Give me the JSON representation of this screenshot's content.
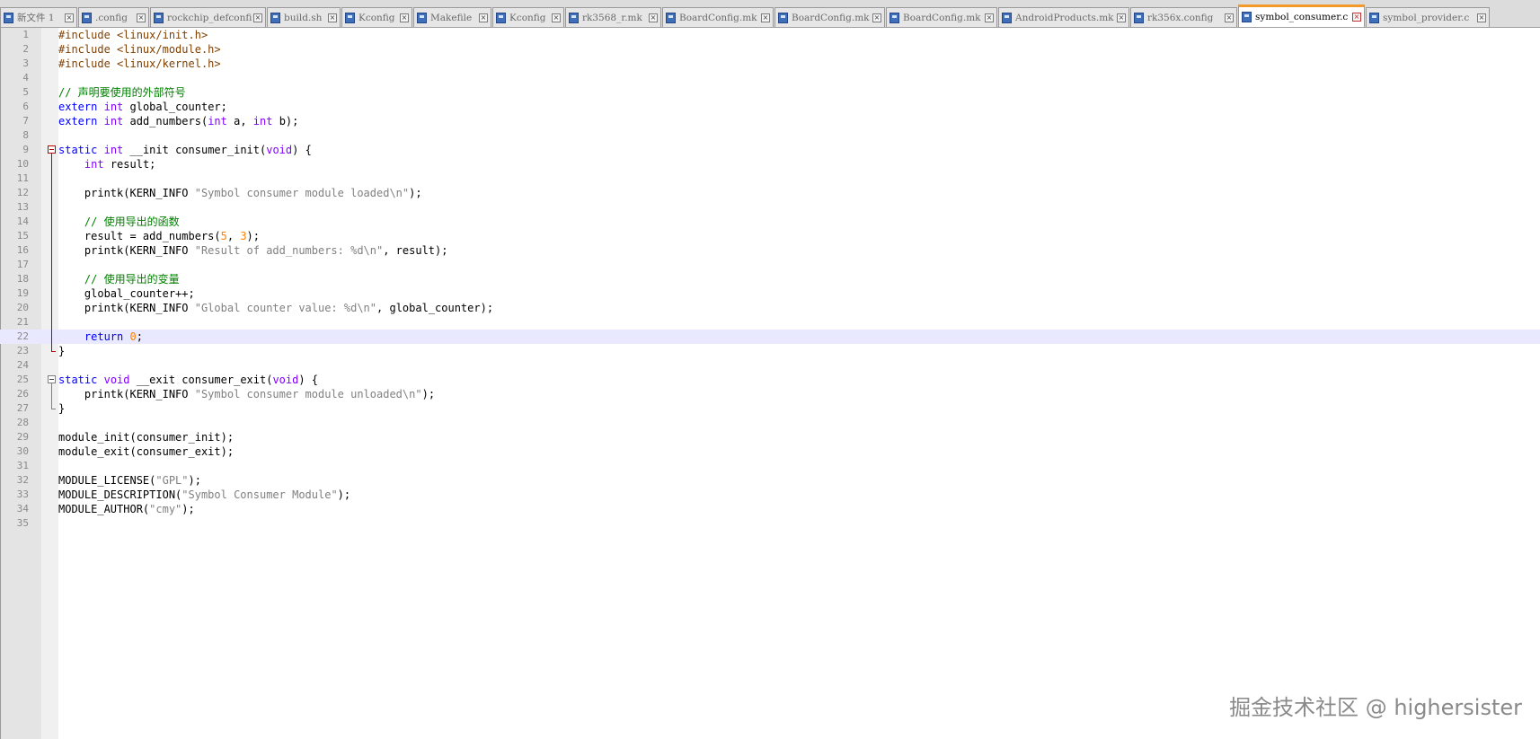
{
  "tabs": [
    {
      "label": "新文件 1",
      "active": false,
      "width": 86
    },
    {
      "label": ".config",
      "active": false,
      "width": 79
    },
    {
      "label": "rockchip_defconfig",
      "active": false,
      "width": 129
    },
    {
      "label": "build.sh",
      "active": false,
      "width": 82
    },
    {
      "label": "Kconfig",
      "active": false,
      "width": 79
    },
    {
      "label": "Makefile",
      "active": false,
      "width": 87
    },
    {
      "label": "Kconfig",
      "active": false,
      "width": 80
    },
    {
      "label": "rk3568_r.mk",
      "active": false,
      "width": 107
    },
    {
      "label": "BoardConfig.mk",
      "active": false,
      "width": 124
    },
    {
      "label": "BoardConfig.mk",
      "active": false,
      "width": 123
    },
    {
      "label": "BoardConfig.mk",
      "active": false,
      "width": 124
    },
    {
      "label": "AndroidProducts.mk",
      "active": false,
      "width": 146
    },
    {
      "label": "rk356x.config",
      "active": false,
      "width": 119
    },
    {
      "label": "symbol_consumer.c",
      "active": true,
      "width": 141
    },
    {
      "label": "symbol_provider.c",
      "active": false,
      "width": 138
    }
  ],
  "editor": {
    "current_line": 22,
    "lines": [
      "#include <linux/init.h>",
      "#include <linux/module.h>",
      "#include <linux/kernel.h>",
      "",
      "// 声明要使用的外部符号",
      "extern int global_counter;",
      "extern int add_numbers(int a, int b);",
      "",
      "static int __init consumer_init(void) {",
      "    int result;",
      "",
      "    printk(KERN_INFO \"Symbol consumer module loaded\\n\");",
      "",
      "    // 使用导出的函数",
      "    result = add_numbers(5, 3);",
      "    printk(KERN_INFO \"Result of add_numbers: %d\\n\", result);",
      "",
      "    // 使用导出的变量",
      "    global_counter++;",
      "    printk(KERN_INFO \"Global counter value: %d\\n\", global_counter);",
      "",
      "    return 0;",
      "}",
      "",
      "static void __exit consumer_exit(void) {",
      "    printk(KERN_INFO \"Symbol consumer module unloaded\\n\");",
      "}",
      "",
      "module_init(consumer_init);",
      "module_exit(consumer_exit);",
      "",
      "MODULE_LICENSE(\"GPL\");",
      "MODULE_DESCRIPTION(\"Symbol Consumer Module\");",
      "MODULE_AUTHOR(\"cmy\");",
      ""
    ]
  },
  "watermark": "掘金技术社区 @ highersister",
  "colors": {
    "keyword": "#0000ff",
    "type": "#8000ff",
    "preprocessor": "#804000",
    "comment": "#008000",
    "string": "#808080",
    "number": "#ff8000",
    "current_line": "#e8e8ff",
    "active_tab_accent": "#f29b2a"
  }
}
